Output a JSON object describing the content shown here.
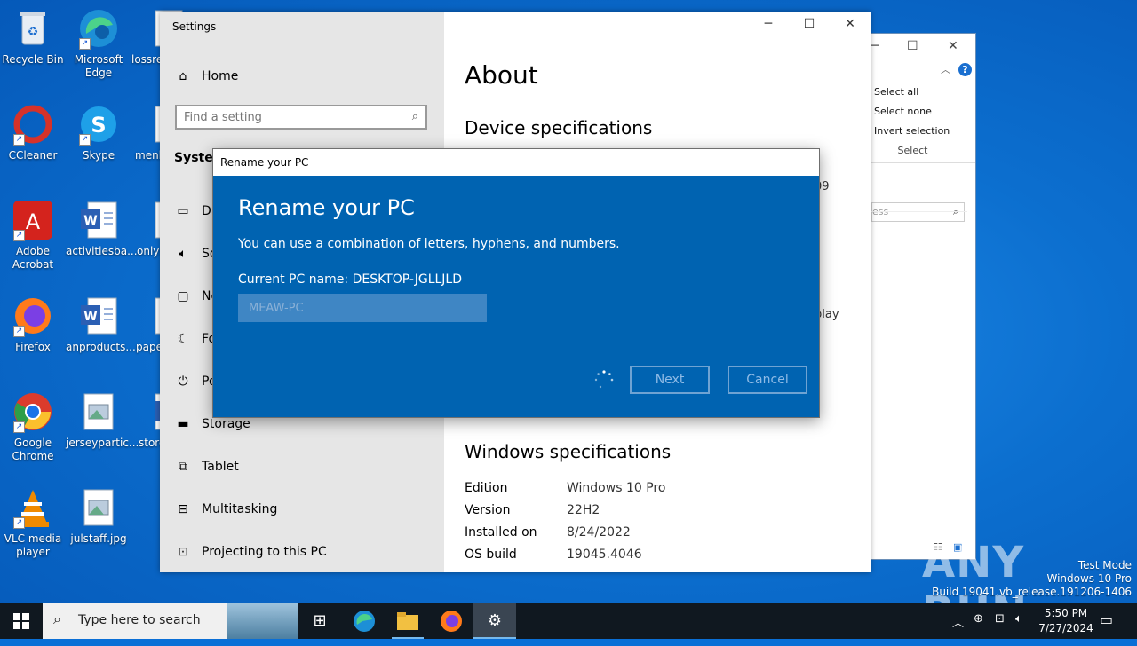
{
  "desktop": {
    "icons": [
      {
        "label": "Recycle Bin"
      },
      {
        "label": "Microsoft Edge"
      },
      {
        "label": "lossre"
      },
      {
        "label": "CCleaner"
      },
      {
        "label": "Skype"
      },
      {
        "label": "menl"
      },
      {
        "label": "Adobe Acrobat"
      },
      {
        "label": "activitiesba..."
      },
      {
        "label": "onlys"
      },
      {
        "label": "Firefox"
      },
      {
        "label": "anproducts..."
      },
      {
        "label": "pape"
      },
      {
        "label": "Google Chrome"
      },
      {
        "label": "jerseypartic..."
      },
      {
        "label": "store"
      },
      {
        "label": "VLC media player"
      },
      {
        "label": "julstaff.jpg"
      }
    ]
  },
  "back_window": {
    "ribbon": [
      "Select all",
      "Select none",
      "Invert selection",
      "Select"
    ],
    "search_placeholder": "ess"
  },
  "settings": {
    "title": "Settings",
    "home_label": "Home",
    "search_placeholder": "Find a setting",
    "section_label": "System",
    "nav": [
      {
        "label": "Di",
        "icon": "display-icon"
      },
      {
        "label": "So",
        "icon": "sound-icon"
      },
      {
        "label": "No",
        "icon": "notifications-icon"
      },
      {
        "label": "Fo",
        "icon": "focus-assist-icon"
      },
      {
        "label": "Po",
        "icon": "power-icon"
      },
      {
        "label": "Storage",
        "icon": "storage-icon"
      },
      {
        "label": "Tablet",
        "icon": "tablet-icon"
      },
      {
        "label": "Multitasking",
        "icon": "multitasking-icon"
      },
      {
        "label": "Projecting to this PC",
        "icon": "projecting-icon"
      }
    ],
    "page_title": "About",
    "device_spec_heading": "Device specifications",
    "partial_09": "09",
    "partial_play": "play",
    "windows_spec_heading": "Windows specifications",
    "windows_spec": [
      {
        "label": "Edition",
        "value": "Windows 10 Pro"
      },
      {
        "label": "Version",
        "value": "22H2"
      },
      {
        "label": "Installed on",
        "value": "8/24/2022"
      },
      {
        "label": "OS build",
        "value": "19045.4046"
      }
    ]
  },
  "dialog": {
    "title": "Rename your PC",
    "heading": "Rename your PC",
    "description": "You can use a combination of letters, hyphens, and numbers.",
    "current_name": "Current PC name: DESKTOP-JGLLJLD",
    "new_name_value": "MEAW-PC",
    "next_label": "Next",
    "cancel_label": "Cancel"
  },
  "taskbar": {
    "search_placeholder": "Type here to search",
    "time": "5:50 PM",
    "date": "7/27/2024"
  },
  "watermark": {
    "brand": "ANY RUN",
    "line1": "Test Mode",
    "line2": "Windows 10 Pro",
    "line3": "Build 19041.vb_release.191206-1406"
  }
}
